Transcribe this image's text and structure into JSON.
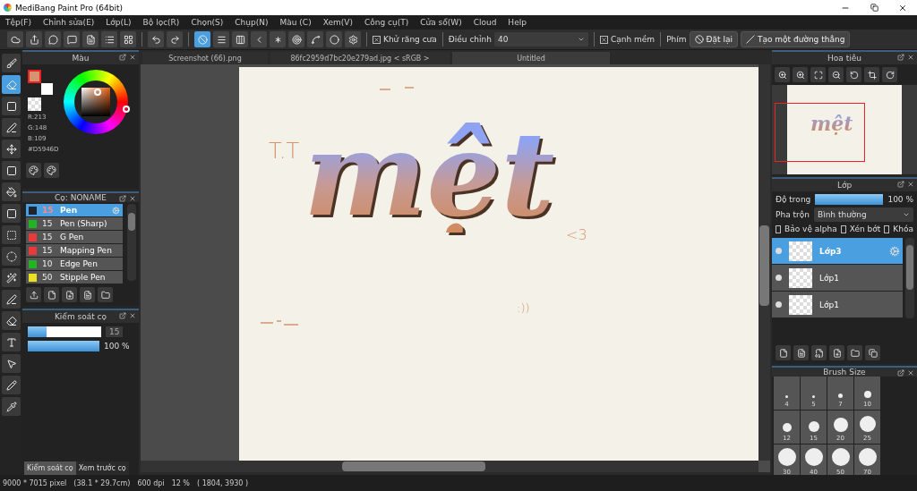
{
  "window": {
    "title": "MediBang Paint Pro (64bit)"
  },
  "menu": [
    "Tệp(F)",
    "Chỉnh sửa(E)",
    "Lớp(L)",
    "Bộ lọc(R)",
    "Chọn(S)",
    "Chụp(N)",
    "Màu (C)",
    "Xem(V)",
    "Công cụ(T)",
    "Cửa sổ(W)",
    "Cloud",
    "Help"
  ],
  "toolbar": {
    "tools": [
      {
        "selected": true
      },
      {
        "selected": false
      },
      {
        "selected": false
      },
      {
        "selected": false
      },
      {
        "selected": false
      },
      {
        "selected": false
      },
      {
        "selected": false
      },
      {
        "selected": false
      },
      {
        "selected": false
      }
    ],
    "antialias": {
      "label": "Khử răng cưa",
      "checked": true
    },
    "adjust_label": "Điều chỉnh",
    "adjust_value": "40",
    "soft_edge": {
      "label": "Cạnh mềm",
      "checked": true
    },
    "keys_label": "Phím",
    "reset_button": "Đặt lại",
    "line_button": "Tạo một đường thẳng"
  },
  "toolbox": [
    {
      "selected": false
    },
    {
      "selected": true
    },
    {
      "selected": false
    },
    {
      "selected": false
    },
    {
      "selected": false
    },
    {
      "selected": false
    },
    {
      "selected": false
    },
    {
      "selected": false
    },
    {
      "selected": false
    },
    {
      "selected": false
    },
    {
      "selected": false
    },
    {
      "selected": false
    },
    {
      "selected": false
    },
    {
      "selected": false
    },
    {
      "selected": false
    },
    {
      "selected": false
    },
    {
      "selected": false
    }
  ],
  "color_panel": {
    "title": "Màu",
    "color": "#d5946d",
    "r": "R:213",
    "g": "G:148",
    "b": "B:109",
    "hex": "#D5946D"
  },
  "brush_panel": {
    "title": "Cọ: NONAME",
    "brushes": [
      {
        "size": "15",
        "name": "Pen",
        "color": "#1e2530",
        "selected": true
      },
      {
        "size": "15",
        "name": "Pen (Sharp)",
        "color": "#22b422",
        "selected": false
      },
      {
        "size": "15",
        "name": "G Pen",
        "color": "#e83a3a",
        "selected": false
      },
      {
        "size": "15",
        "name": "Mapping Pen",
        "color": "#e83a3a",
        "selected": false
      },
      {
        "size": "10",
        "name": "Edge Pen",
        "color": "#22b422",
        "selected": false
      },
      {
        "size": "50",
        "name": "Stipple Pen",
        "color": "#e8e020",
        "selected": false
      }
    ]
  },
  "brush_control": {
    "title": "Kiểm soát cọ",
    "size": {
      "level": 0.25,
      "value": "15"
    },
    "opacity": {
      "level": 1,
      "value": "100 %"
    }
  },
  "left_tabs": [
    {
      "label": "Kiểm soát cọ",
      "selected": true
    },
    {
      "label": "Xem trước cọ",
      "selected": false
    }
  ],
  "doc_tabs": [
    {
      "label": "Screenshot (66).png",
      "selected": false
    },
    {
      "label": "86fc2959d7bc20e279ad.jpg < sRGB >",
      "selected": false
    },
    {
      "label": "Untitled",
      "selected": true
    }
  ],
  "canvas": {
    "word": "mệt",
    "face": "T.T",
    "heart": "<3",
    "smile": ":))"
  },
  "navigator": {
    "title": "Hoa tiêu",
    "preview_word": "mệt"
  },
  "layers": {
    "title": "Lớp",
    "opacity_label": "Độ trong",
    "opacity": {
      "level": 1,
      "value": "100 %"
    },
    "blend_label": "Pha trộn",
    "blend_value": "Bình thường",
    "options": [
      {
        "label": "Bảo vệ alpha",
        "checked": false
      },
      {
        "label": "Xén bớt",
        "checked": false
      },
      {
        "label": "Khóa",
        "checked": false
      }
    ],
    "items": [
      {
        "name": "Lớp3",
        "selected": true
      },
      {
        "name": "Lớp1",
        "selected": false
      },
      {
        "name": "Lớp1",
        "selected": false
      }
    ]
  },
  "brush_size": {
    "title": "Brush Size",
    "sizes": [
      "4",
      "5",
      "7",
      "10",
      "12",
      "15",
      "20",
      "25",
      "30",
      "40",
      "50",
      "70"
    ]
  },
  "status_bar": {
    "pixels": "9000 * 7015 pixel",
    "physical": "(38.1 * 29.7cm)",
    "dpi": "600 dpi",
    "zoom": "12 %",
    "cursor": "( 1804, 3930 )"
  }
}
